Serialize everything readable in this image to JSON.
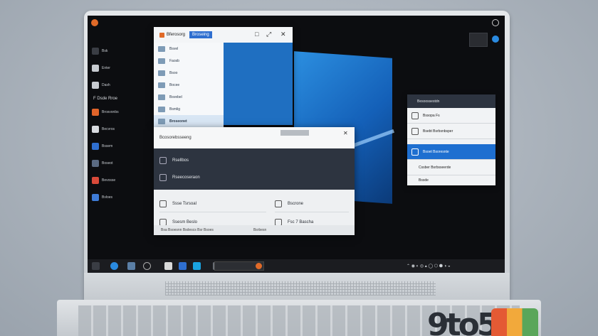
{
  "scene": {
    "watermark": "9to5",
    "colors": {
      "accent": "#1e6fd0",
      "wallpaper": "#1460b8",
      "dark_panel": "#2d3440"
    }
  },
  "screen": {
    "left_panel": {
      "items_top": [
        "Bsk",
        "Enter",
        "Dash"
      ],
      "section_label": "F Dsde Rroe",
      "items": [
        "Brosvonbs",
        "Becvros",
        "Bssem",
        "Boseot",
        "Bevosse",
        "Bvloes"
      ]
    },
    "file_window": {
      "tab_label": "Bferosorg",
      "tab2_label": "Broseing",
      "rows": [
        "Bsvel",
        "Faosb",
        "Bsoo",
        "Bocee",
        "Bsvebel",
        "Bsmlig",
        "Broseonet"
      ],
      "active_row": 6
    },
    "settings_window": {
      "title": "Bcosorebsseeng",
      "dark_rows": [
        "Rsellbos",
        "Rseecoseraon"
      ],
      "light_left": [
        "Ssse Tsrsoal",
        "Ssesm Beslo"
      ],
      "light_right": [
        "Bscrone",
        "Fsc 7 Bascha",
        "Bsrbesn"
      ],
      "footer": "Bsa Bsoesnn Bsdescs Bsr Bsoes"
    },
    "right_window": {
      "header": "Besoossestdn",
      "rows": [
        "Bssopa Fs",
        "Bsebt Bsrbsnbsper",
        "Bsoet Bsoresnte",
        "Cssber Bsrbsseerde",
        "Bssde"
      ],
      "selected_row": 3
    }
  }
}
